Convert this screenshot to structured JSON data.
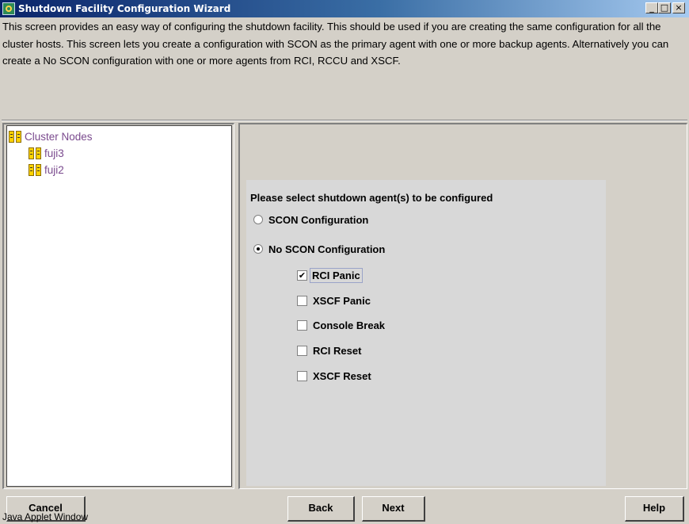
{
  "window": {
    "title": "Shutdown Facility Configuration Wizard",
    "minimize": "_",
    "maximize": "□",
    "close": "×"
  },
  "description": "This screen provides an easy way of configuring the shutdown facility. This should be used if you are creating the same configuration for all the cluster hosts. This screen lets you create a configuration with SCON as the primary agent with one or more backup agents. Alternatively you can create a No SCON configuration with one or more agents from RCI, RCCU and XSCF.",
  "tree": {
    "root": "Cluster Nodes",
    "nodes": [
      "fuji3",
      "fuji2"
    ]
  },
  "options": {
    "prompt": "Please select shutdown agent(s) to be configured",
    "radio_scon": {
      "label": "SCON Configuration",
      "selected": false
    },
    "radio_noscon": {
      "label": "No SCON Configuration",
      "selected": true
    },
    "agents": [
      {
        "label": "RCI Panic",
        "checked": true
      },
      {
        "label": "XSCF Panic",
        "checked": false
      },
      {
        "label": "Console Break",
        "checked": false
      },
      {
        "label": "RCI Reset",
        "checked": false
      },
      {
        "label": "XSCF Reset",
        "checked": false
      }
    ],
    "check_mark": "✔"
  },
  "buttons": {
    "cancel": "Cancel",
    "back": "Back",
    "next": "Next",
    "help": "Help"
  },
  "status": "Java Applet Window"
}
